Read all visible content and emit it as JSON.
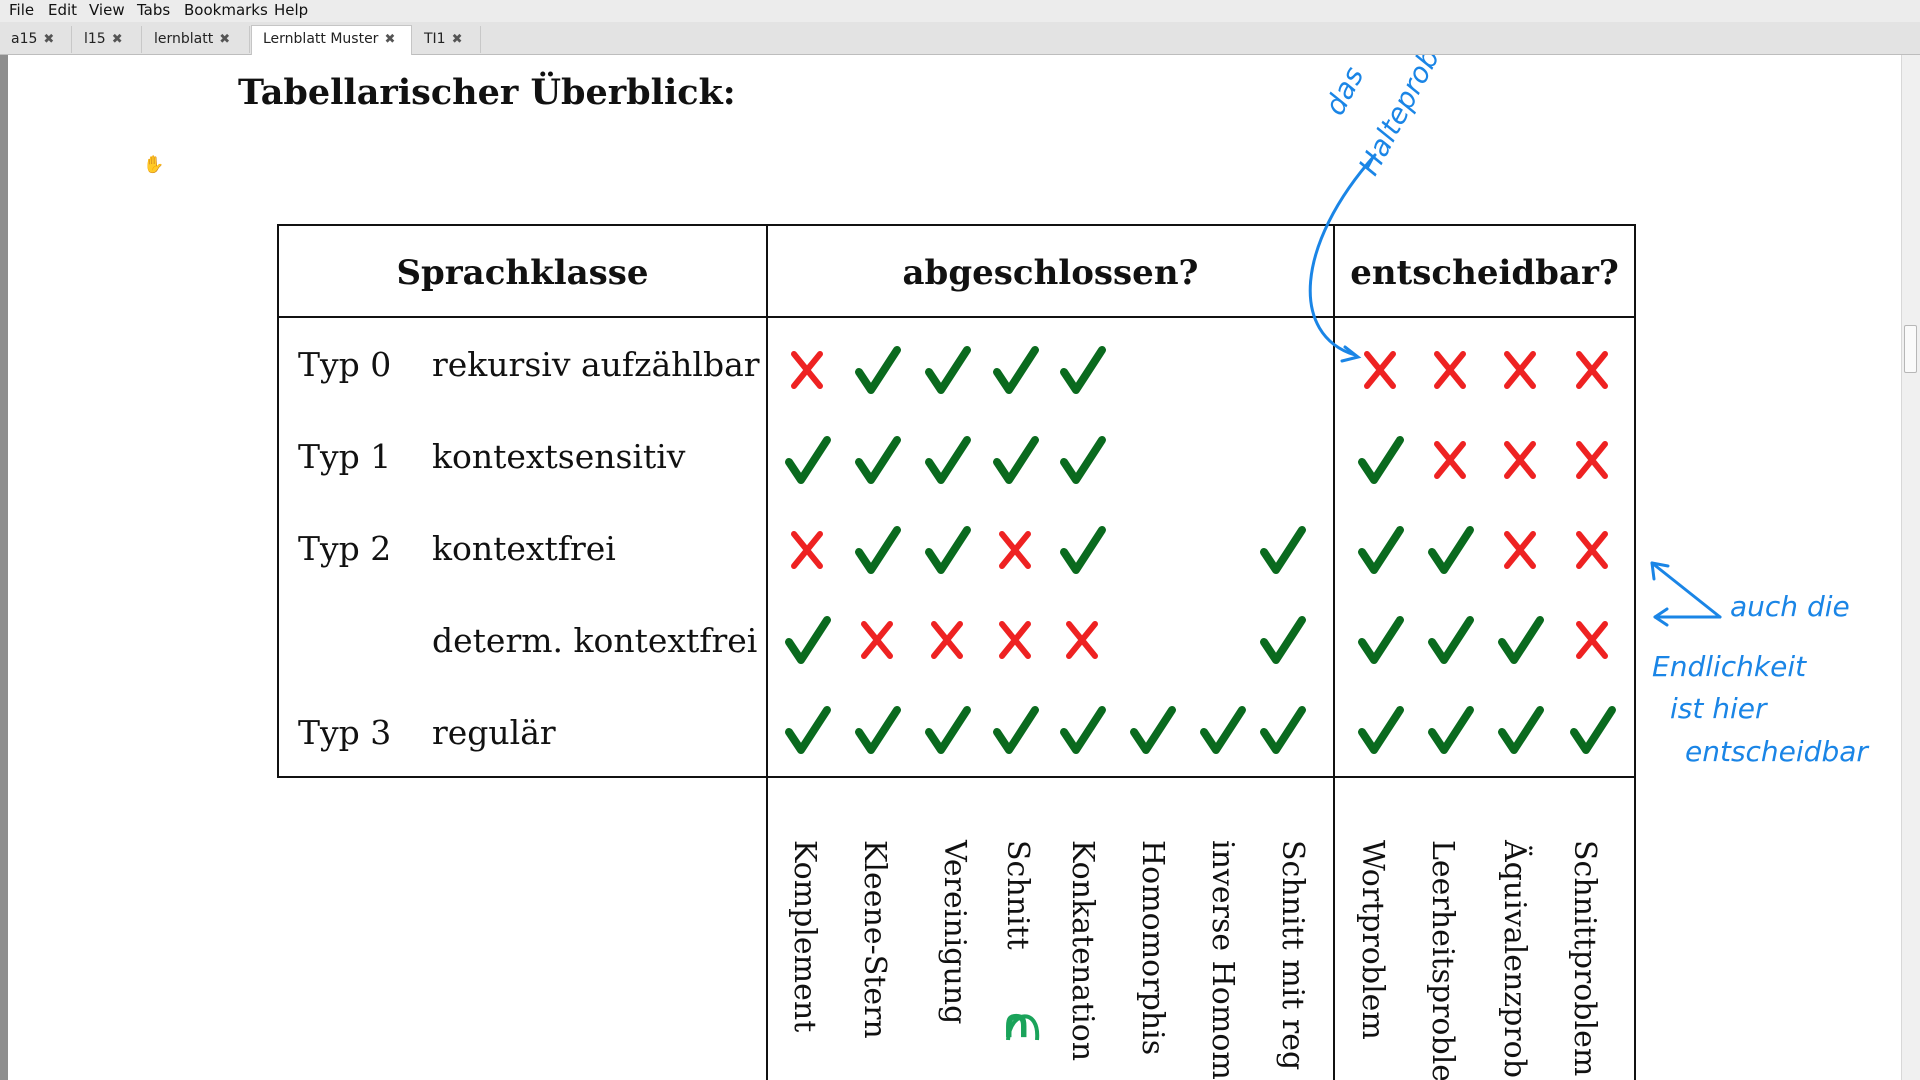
{
  "menubar": {
    "items": [
      "File",
      "Edit",
      "View",
      "Tabs",
      "Bookmarks",
      "Help"
    ]
  },
  "tabs": [
    {
      "label": "a15",
      "active": false
    },
    {
      "label": "l15",
      "active": false
    },
    {
      "label": "lernblatt",
      "active": false
    },
    {
      "label": "Lernblatt Muster",
      "active": true
    },
    {
      "label": "TI1",
      "active": false
    }
  ],
  "tab_close_icon": "✖",
  "document": {
    "heading": "Tabellarischer Überblick:",
    "table": {
      "headers": {
        "class": "Sprachklasse",
        "closed": "abgeschlossen?",
        "decidable": "entscheidbar?"
      },
      "rows": [
        {
          "type": "Typ 0",
          "name": "rekursiv aufzählbar",
          "closure": [
            "x",
            "check",
            "check",
            "check",
            "check",
            "",
            "",
            ""
          ],
          "decidable": [
            "x",
            "x",
            "x",
            "x"
          ]
        },
        {
          "type": "Typ 1",
          "name": "kontextsensitiv",
          "closure": [
            "check",
            "check",
            "check",
            "check",
            "check",
            "",
            "",
            ""
          ],
          "decidable": [
            "check",
            "x",
            "x",
            "x"
          ]
        },
        {
          "type": "Typ 2",
          "name": "kontextfrei",
          "closure": [
            "x",
            "check",
            "check",
            "x",
            "check",
            "",
            "",
            "check"
          ],
          "decidable": [
            "check",
            "check",
            "x",
            "x"
          ]
        },
        {
          "type": "",
          "name": "determ. kontextfrei",
          "closure": [
            "check",
            "x",
            "x",
            "x",
            "x",
            "",
            "",
            "check"
          ],
          "decidable": [
            "check",
            "check",
            "check",
            "x"
          ]
        },
        {
          "type": "Typ 3",
          "name": "regulär",
          "closure": [
            "check",
            "check",
            "check",
            "check",
            "check",
            "check",
            "check",
            "check"
          ],
          "decidable": [
            "check",
            "check",
            "check",
            "check"
          ]
        }
      ],
      "closure_ops": [
        "Komplement",
        "Kleene-Stern",
        "Vereinigung",
        "Schnitt",
        "Konkatenation",
        "Homomorphis",
        "inverse Homom",
        "Schnitt mit reg"
      ],
      "decision_problems": [
        "Wortproblem",
        "Leerheitsproble",
        "Äquivalenzprob",
        "Schnittproblem"
      ]
    },
    "handwritten": {
      "schnitt_symbol": "∩",
      "arrow_note": [
        "das",
        "Halteprobl"
      ],
      "side_note": [
        "auch die",
        "Endlichkeit",
        "ist hier",
        "entscheidbar"
      ]
    }
  },
  "colors": {
    "check": "#0a6a1e",
    "cross": "#ee2222",
    "annotation": "#1a85e6",
    "highlight": "#1aa35a"
  }
}
